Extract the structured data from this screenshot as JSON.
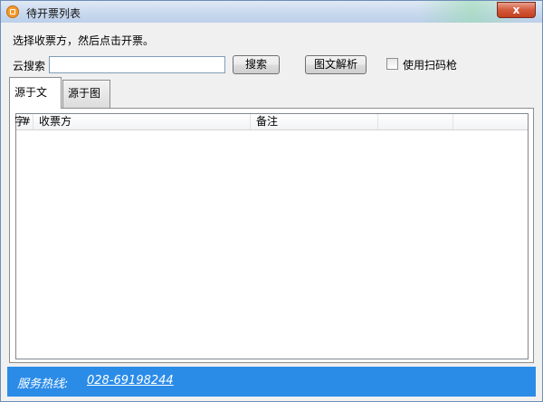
{
  "window": {
    "title": "待开票列表",
    "close_label": "x"
  },
  "main": {
    "instruction": "选择收票方，然后点击开票。",
    "search_label": "云搜索",
    "search_value": "",
    "search_button": "搜索",
    "parse_button": "图文解析",
    "scanner_checkbox_label": "使用扫码枪",
    "scanner_checked": false
  },
  "tabs": [
    {
      "label": "源于文字",
      "active": true
    },
    {
      "label": "源于图片",
      "active": false
    }
  ],
  "table": {
    "columns": [
      "#",
      "收票方",
      "备注",
      "",
      ""
    ],
    "rows": []
  },
  "status": {
    "hotline_label": "服务热线:",
    "hotline_number": "028-69198244"
  },
  "colors": {
    "statusbar": "#2b8ce8",
    "titlebar": "#c9d9ee",
    "close_button": "#d4583b"
  }
}
